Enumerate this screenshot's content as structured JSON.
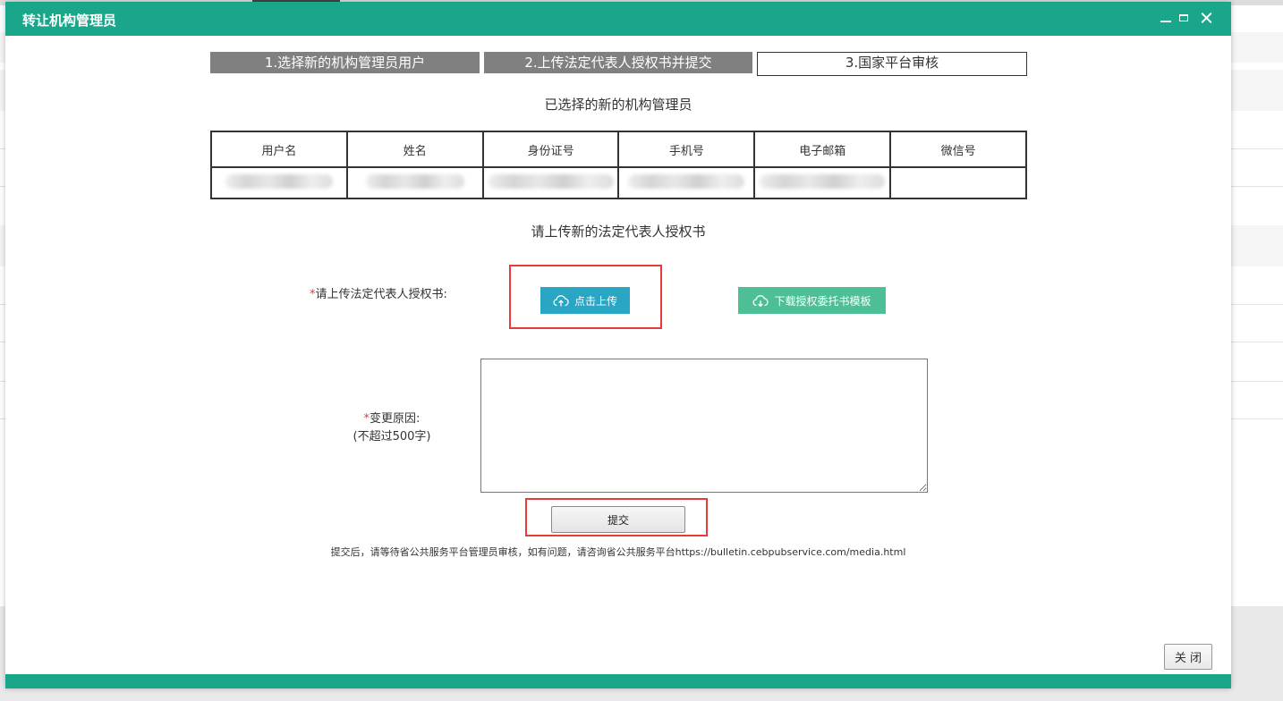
{
  "modal": {
    "title": "转让机构管理员"
  },
  "steps": [
    {
      "label": "1.选择新的机构管理员用户",
      "state": "done"
    },
    {
      "label": "2.上传法定代表人授权书并提交",
      "state": "done"
    },
    {
      "label": "3.国家平台审核",
      "state": "current"
    }
  ],
  "selected_section": {
    "title": "已选择的新的机构管理员",
    "columns": [
      "用户名",
      "姓名",
      "身份证号",
      "手机号",
      "电子邮箱",
      "微信号"
    ]
  },
  "upload_section": {
    "title": "请上传新的法定代表人授权书",
    "label_required_mark": "*",
    "label": "请上传法定代表人授权书:",
    "upload_button": "点击上传",
    "upload_icon": "cloud-upload-icon",
    "template_button": "下载授权委托书模板",
    "template_icon": "cloud-download-icon"
  },
  "reason": {
    "required_mark": "*",
    "label": "变更原因:",
    "hint": "(不超过500字)",
    "value": ""
  },
  "submit_button": "提交",
  "note": "提交后，请等待省公共服务平台管理员审核，如有问题，请咨询省公共服务平台https://bulletin.cebpubservice.com/media.html",
  "close_button": "关 闭",
  "colors": {
    "header": "#1aa68a",
    "step_done": "#808080",
    "upload_button": "#2aa6c5",
    "template_button": "#4cbf94",
    "highlight_box": "#e53b3b"
  }
}
